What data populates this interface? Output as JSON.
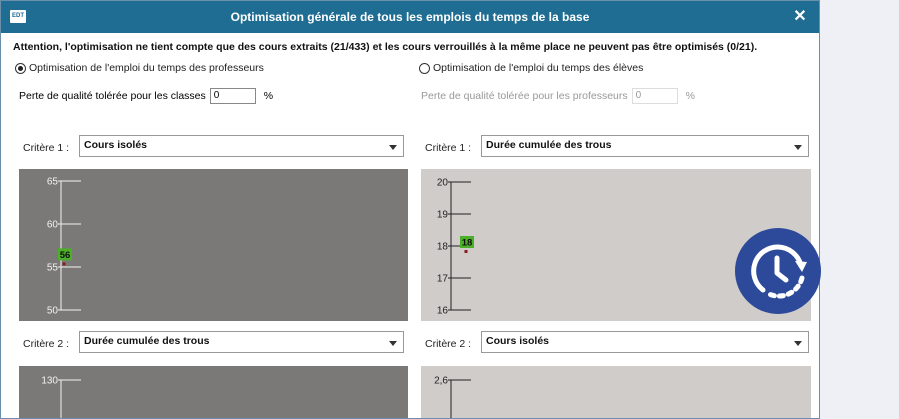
{
  "window": {
    "app_icon_text": "EDT",
    "title": "Optimisation générale de tous les emplois du temps de la base",
    "close_label": "✕"
  },
  "warning": "Attention, l'optimisation ne tient compte que des cours extraits (21/433) et les cours verrouillés à la même place ne peuvent pas être optimisés (0/21).",
  "options": {
    "teachers": {
      "label": "Optimisation de l'emploi du temps des professeurs",
      "selected": true
    },
    "students": {
      "label": "Optimisation de l'emploi du temps des élèves",
      "selected": false
    }
  },
  "tolerance": {
    "classes": {
      "label": "Perte de qualité tolérée pour les classes",
      "value": "0",
      "unit": "%"
    },
    "teachers": {
      "label": "Perte de qualité tolérée pour les professeurs",
      "value": "0",
      "unit": "%"
    }
  },
  "criteria": {
    "left1": {
      "label": "Critère 1 :",
      "value": "Cours isolés"
    },
    "right1": {
      "label": "Critère 1 :",
      "value": "Durée cumulée des trous"
    },
    "left2": {
      "label": "Critère 2 :",
      "value": "Durée cumulée des trous"
    },
    "right2": {
      "label": "Critère 2 :",
      "value": "Cours isolés"
    }
  },
  "colors": {
    "titlebar": "#1f6d92",
    "plot_active": "#7a7978",
    "plot_inactive": "#cfccca",
    "point": "#4caf28",
    "badge": "#2d4a9a"
  },
  "chart_data": [
    {
      "type": "scatter",
      "name": "left-criterion-1",
      "ylim": [
        50,
        65
      ],
      "ticks": [
        65,
        60,
        55,
        50
      ],
      "tick_labels": [
        "65",
        "60",
        "55",
        "50"
      ],
      "points": [
        {
          "x": 0,
          "y": 56,
          "label": "56"
        }
      ]
    },
    {
      "type": "scatter",
      "name": "right-criterion-1",
      "ylim": [
        16,
        20
      ],
      "ticks": [
        20,
        19,
        18,
        17,
        16
      ],
      "tick_labels": [
        "20",
        "19",
        "18",
        "17",
        "16"
      ],
      "points": [
        {
          "x": 0,
          "y": 18,
          "label": "18"
        }
      ]
    },
    {
      "type": "scatter",
      "name": "left-criterion-2",
      "ticks": [
        130
      ],
      "tick_labels": [
        "130"
      ],
      "points": []
    },
    {
      "type": "scatter",
      "name": "right-criterion-2",
      "ticks": [
        2.6
      ],
      "tick_labels": [
        "2,6"
      ],
      "points": []
    }
  ]
}
